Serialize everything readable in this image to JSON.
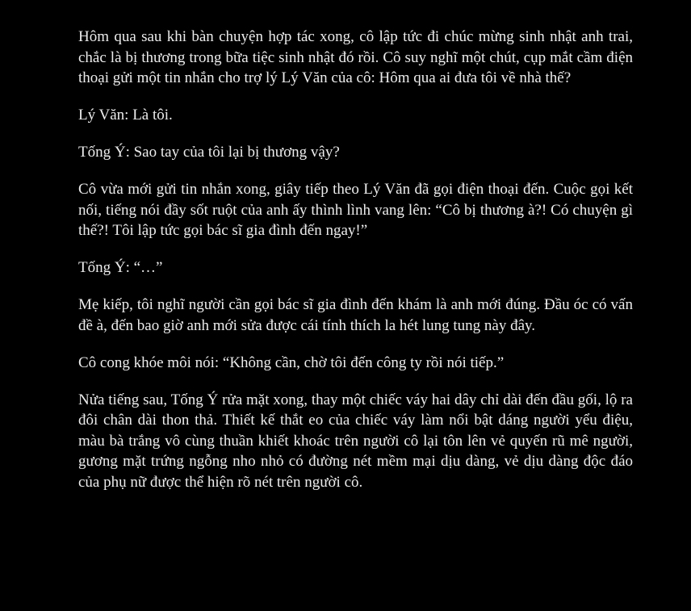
{
  "paragraphs": [
    "Hôm qua sau khi bàn chuyện hợp tác xong, cô lập tức đi chúc mừng sinh nhật anh trai, chắc là bị thương trong bữa tiệc sinh nhật đó rồi. Cô suy nghĩ một chút, cụp mắt cầm điện thoại gửi một tin nhắn cho trợ lý Lý Văn của cô: Hôm qua ai đưa tôi về nhà thế?",
    "Lý Văn: Là tôi.",
    "Tống Ý: Sao tay của tôi lại bị thương vậy?",
    "Cô vừa mới gửi tin nhắn xong, giây tiếp theo Lý Văn đã gọi điện thoại đến. Cuộc gọi kết nối, tiếng nói đầy sốt ruột của anh ấy thình lình vang lên: “Cô bị thương à?! Có chuyện gì thế?! Tôi lập tức gọi bác sĩ gia đình đến ngay!”",
    "Tống Ý: “…”",
    "Mẹ kiếp, tôi nghĩ người cần gọi bác sĩ gia đình đến khám là anh mới đúng. Đầu óc có vấn đề à, đến bao giờ anh mới sửa được cái tính thích la hét lung tung này đây.",
    "Cô cong khóe môi nói: “Không cần, chờ tôi đến công ty rồi nói tiếp.”",
    "Nửa tiếng sau, Tống Ý rửa mặt xong, thay một chiếc váy hai dây chỉ dài đến đầu gối, lộ ra đôi chân dài thon thả. Thiết kế thắt eo của chiếc váy làm nổi bật dáng người yểu điệu, màu bà trắng vô cùng thuần khiết khoác trên người cô lại tôn lên vẻ quyến rũ mê người, gương mặt trứng ngỗng nho nhỏ có đường nét mềm mại dịu dàng, vẻ dịu dàng độc đáo của phụ nữ được thể hiện rõ nét trên người cô."
  ]
}
